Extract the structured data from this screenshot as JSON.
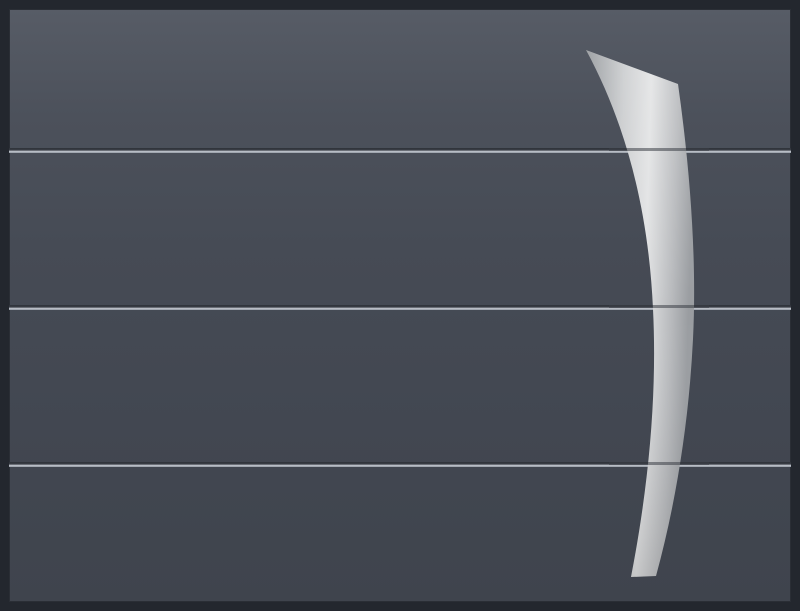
{
  "scene": {
    "subject": "garage-door",
    "panels": 4,
    "colors": {
      "panel": "#474c56",
      "frame": "#23272e",
      "steel": "#c8cacc"
    },
    "ornament": "brushed-steel-curved-blade"
  }
}
